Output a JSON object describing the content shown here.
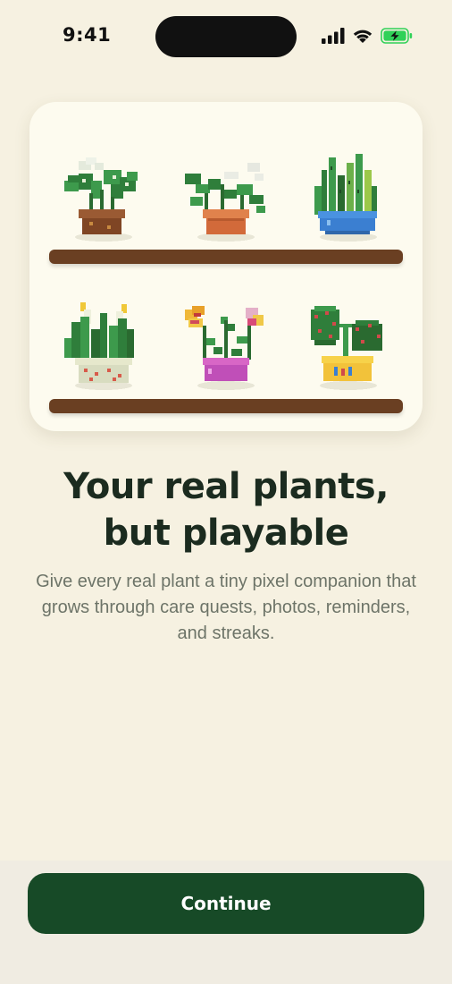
{
  "status": {
    "time": "9:41",
    "icons": [
      "cellular-signal-icon",
      "wifi-icon",
      "battery-charging-icon"
    ],
    "battery_color": "#30d158"
  },
  "shelf": {
    "plants": [
      {
        "name": "monstera",
        "pot_color": "#8a4f2c"
      },
      {
        "name": "pilea",
        "pot_color": "#d26a3a"
      },
      {
        "name": "snake-plant",
        "pot_color": "#3b7fd1"
      },
      {
        "name": "peace-lily",
        "pot_color": "#d8dcc0"
      },
      {
        "name": "flowering-plant",
        "pot_color": "#c04fb8"
      },
      {
        "name": "cactus",
        "pot_color": "#f2c23a"
      }
    ]
  },
  "onboarding": {
    "title_line1": "Your real plants,",
    "title_line2": "but playable",
    "subtitle": "Give every real plant a tiny pixel companion that grows through care quests, photos, reminders, and streaks."
  },
  "actions": {
    "continue_label": "Continue"
  },
  "colors": {
    "background": "#f6f1e1",
    "accent": "#174a27",
    "title": "#1b2b1f",
    "subtitle": "#6d7468"
  }
}
